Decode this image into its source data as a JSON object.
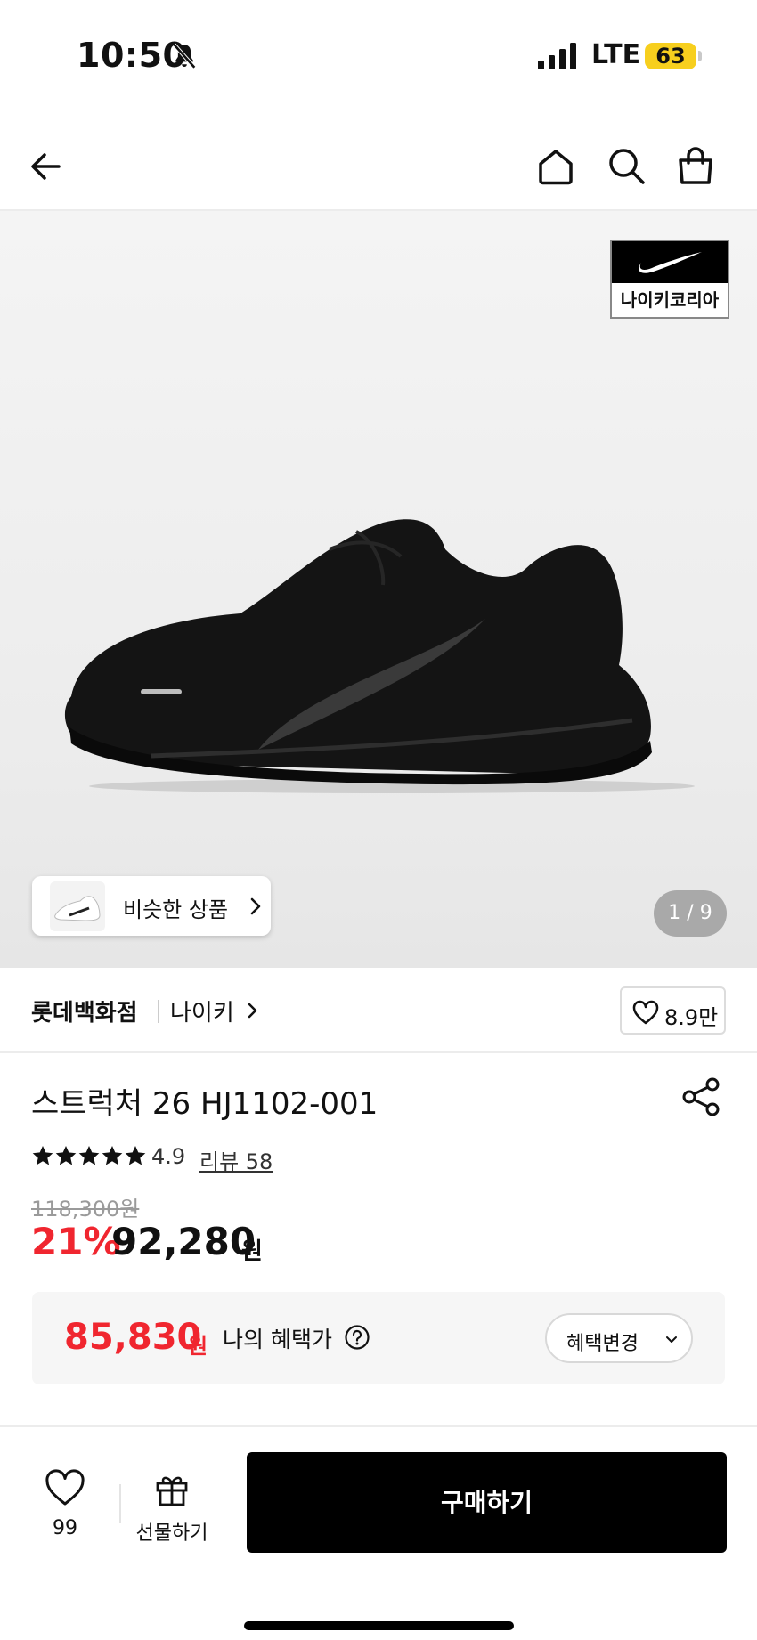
{
  "status_bar": {
    "time": "10:50",
    "network": "LTE",
    "battery": "63",
    "battery_color": "#f7cf1e"
  },
  "nav": {
    "icons": [
      "back-arrow-icon",
      "home-icon",
      "search-icon",
      "shopping-bag-icon"
    ]
  },
  "hero": {
    "brand_badge_text": "나이키코리아",
    "similar_label": "비슷한 상품",
    "pager": "1 / 9"
  },
  "store": {
    "name": "롯데백화점",
    "brand": "나이키",
    "likes": "8.9만"
  },
  "product": {
    "title": "스트럭처 26 HJ1102-001",
    "rating": "4.9",
    "stars": 5,
    "review_label": "리뷰 58",
    "original_price": "118,300원",
    "discount": "21%",
    "sale_price": "92,280",
    "sale_unit": "원"
  },
  "benefit": {
    "price": "85,830",
    "unit": "원",
    "label": "나의 혜택가",
    "change_label": "혜택변경"
  },
  "bottom_bar": {
    "wish_count": "99",
    "gift_label": "선물하기",
    "buy_label": "구매하기"
  },
  "colors": {
    "accent_red": "#f0262f",
    "buy_button": "#000000"
  }
}
